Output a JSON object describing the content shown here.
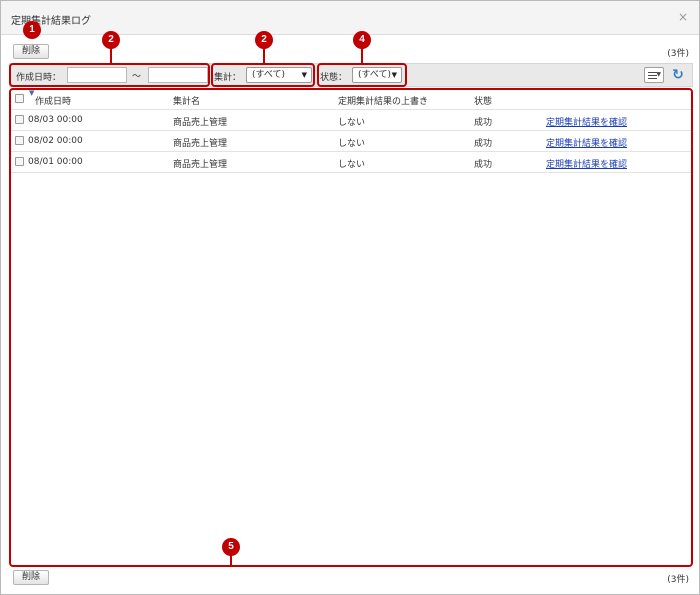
{
  "window": {
    "title": "定期集計結果ログ",
    "close_icon": "close-icon"
  },
  "top": {
    "delete_label": "削除",
    "count": "(3件)"
  },
  "bottom": {
    "delete_label": "削除",
    "count": "(3件)"
  },
  "filters": {
    "created_label": "作成日時：",
    "range_sep": "～",
    "from_value": "",
    "to_value": "",
    "aggregation_label": "集計：",
    "aggregation_value": "(すべて)",
    "status_label": "状態：",
    "status_value": "(すべて)"
  },
  "table": {
    "columns": [
      "作成日時",
      "集計名",
      "定期集計結果の上書き",
      "状態",
      ""
    ],
    "rows": [
      {
        "created": "08/03 00:00",
        "name": "商品売上管理",
        "overwrite": "しない",
        "status": "成功",
        "action": "定期集計結果を確認"
      },
      {
        "created": "08/02 00:00",
        "name": "商品売上管理",
        "overwrite": "しない",
        "status": "成功",
        "action": "定期集計結果を確認"
      },
      {
        "created": "08/01 00:00",
        "name": "商品売上管理",
        "overwrite": "しない",
        "status": "成功",
        "action": "定期集計結果を確認"
      }
    ]
  },
  "callouts": [
    "1",
    "2",
    "2",
    "4",
    "5"
  ],
  "colors": {
    "callout": "#c00000",
    "link": "#1a3db6",
    "refresh": "#2f7fc4"
  }
}
